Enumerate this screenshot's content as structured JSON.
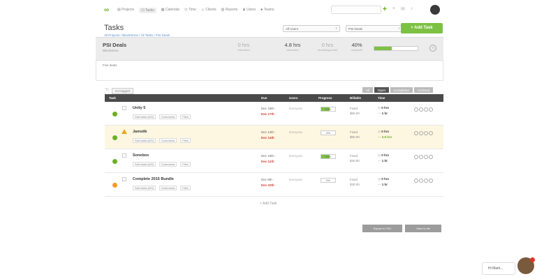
{
  "nav": {
    "items": [
      {
        "label": "Projects",
        "icon": "folder-icon"
      },
      {
        "label": "Tasks",
        "icon": "check-icon"
      },
      {
        "label": "Calendar",
        "icon": "calendar-icon"
      },
      {
        "label": "Time",
        "icon": "clock-icon"
      },
      {
        "label": "Clients",
        "icon": "clients-icon"
      },
      {
        "label": "Reports",
        "icon": "chart-icon"
      },
      {
        "label": "Users",
        "icon": "user-icon"
      },
      {
        "label": "Teams",
        "icon": "team-icon"
      }
    ]
  },
  "page": {
    "title": "Tasks",
    "breadcrumb": "All Projects / BlackStone / All Tasks / PSI Deals",
    "filter_users": "All Users",
    "filter_status": "PSI Deals",
    "add_task_label": "+ Add Task"
  },
  "project": {
    "name": "PSI Deals",
    "client": "BlackStone",
    "estimated_value": "0 hrs",
    "estimated_label": "estimated",
    "tracked_value": "4.8 hrs",
    "tracked_label": "estimated",
    "remaining_value": "0 hrs",
    "remaining_label": "remaining/credit",
    "percent_value": "40%",
    "percent_label": "complete",
    "progress": 0.4,
    "notes": "Five deals"
  },
  "toolbar": {
    "tag_filter": "not tagged",
    "tabs": [
      "All",
      "Open",
      "Completed",
      "Archived"
    ],
    "active_tab": "Open"
  },
  "table": {
    "headers": [
      "Task",
      "Due",
      "Users",
      "Progress",
      "Billable",
      "Time"
    ],
    "rows": [
      {
        "name": "Unity 5",
        "status_color": "#6ab023",
        "warn": false,
        "meta": [
          "Sub tasks (0/0)",
          "Comments",
          "Files"
        ],
        "due1": "Dec 16th -",
        "due2": "Dec 17th",
        "user": "Everyone",
        "progress": 0.6,
        "progress_label": "60%",
        "billed1": "Fixed",
        "billed2": "$60.00",
        "time1": "0 hrs",
        "time2": "1 hr"
      },
      {
        "name": "Jamstik",
        "status_color": "#6ab023",
        "warn": true,
        "meta": [
          "Sub tasks (0/0)",
          "Comments",
          "Files"
        ],
        "due1": "Dec 13th -",
        "due2": "Dec 14th",
        "user": "Everyone",
        "progress": 0.0,
        "progress_label": "0%",
        "billed1": "Fixed",
        "billed2": "$50.00",
        "time1": "0 hrs",
        "time2": "0.8 hrs"
      },
      {
        "name": "Sonebox",
        "status_color": "#6ab023",
        "warn": false,
        "meta": [
          "Sub tasks (0/0)",
          "Comments",
          "Files"
        ],
        "due1": "Dec 10th -",
        "due2": "Dec 11th",
        "user": "Everyone",
        "progress": 0.6,
        "progress_label": "60%",
        "billed1": "Fixed",
        "billed2": "$40.00",
        "time1": "0 hrs",
        "time2": "1 hr"
      },
      {
        "name": "Complete 2015 Bundle",
        "status_color": "#f39c1f",
        "warn": false,
        "meta": [
          "Sub tasks (0/0)",
          "Comments",
          "Files"
        ],
        "due1": "Dec 9th -",
        "due2": "Dec 10th",
        "user": "Everyone",
        "progress": 0.0,
        "progress_label": "0%",
        "billed1": "Fixed",
        "billed2": "$30.00",
        "time1": "0 hrs",
        "time2": "1 hr"
      }
    ]
  },
  "footer": {
    "add_task": "+ Add Task",
    "export_label": "Export to CSV",
    "save_label": "Save to list"
  },
  "chat": {
    "greeting": "Hi Mark..."
  }
}
